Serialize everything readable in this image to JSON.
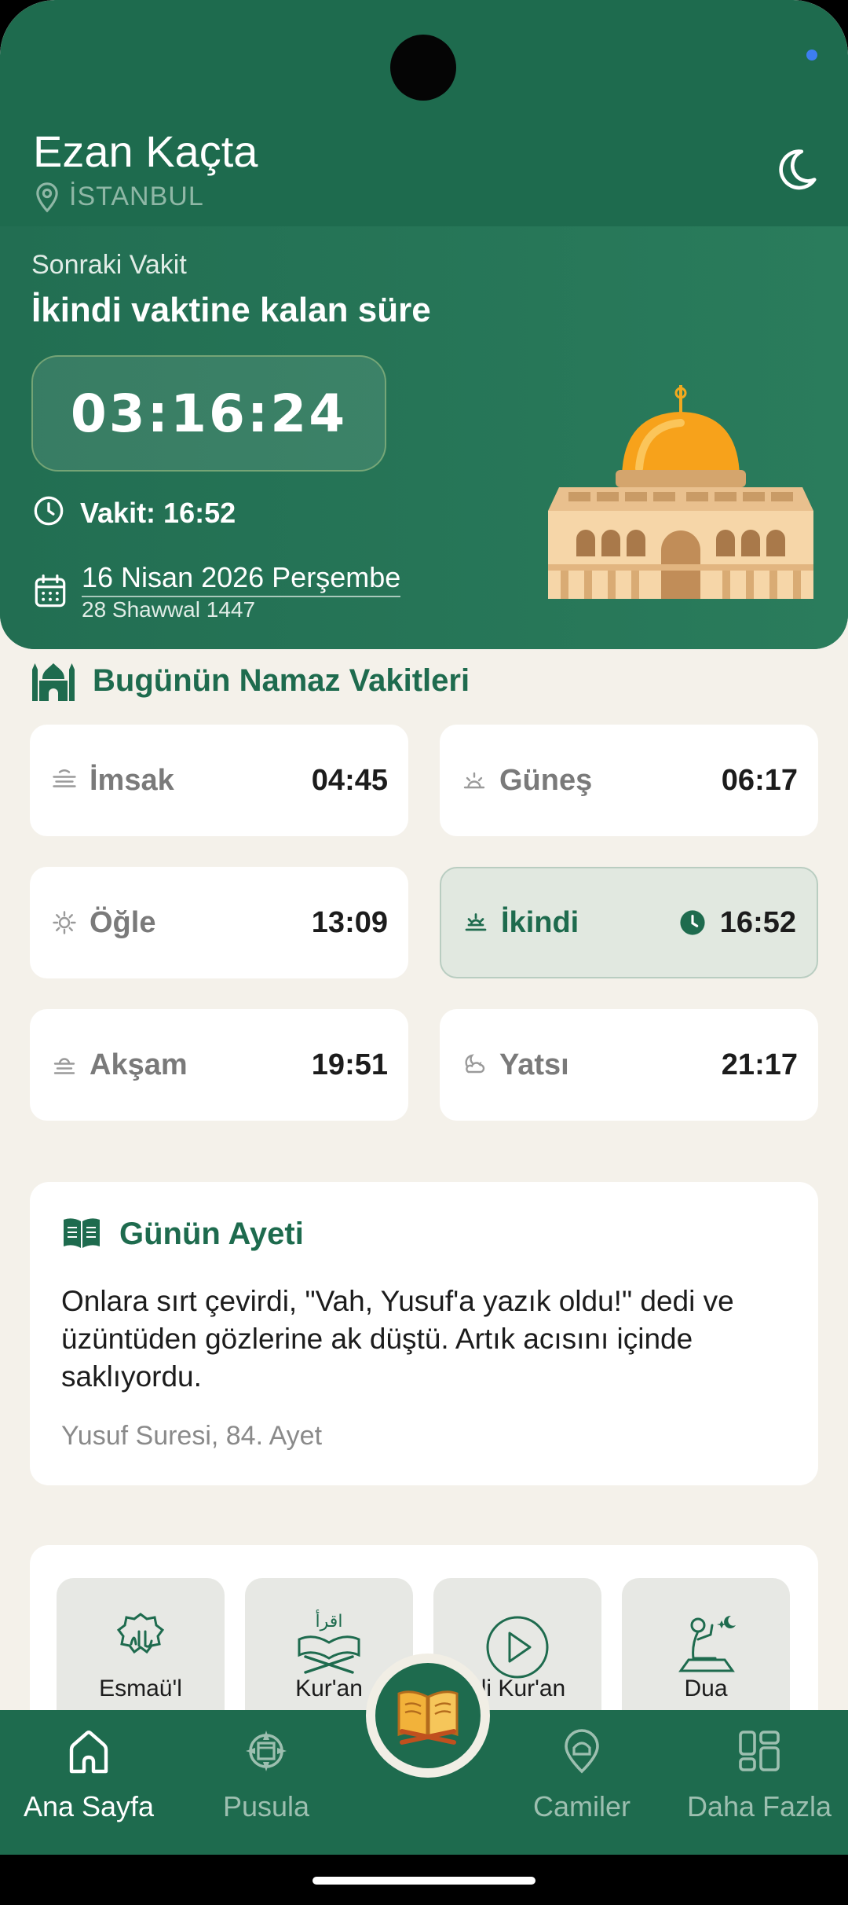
{
  "app": {
    "title": "Ezan Kaçta",
    "location": "İSTANBUL"
  },
  "next": {
    "label": "Sonraki Vakit",
    "title": "İkindi vaktine kalan süre",
    "countdown": "03:16:24",
    "vakit": "Vakit: 16:52",
    "gregorian_date": "16 Nisan 2026 Perşembe",
    "hijri_date": "28 Shawwal 1447"
  },
  "prayers": {
    "section_title": "Bugünün Namaz Vakitleri",
    "items": [
      {
        "name": "İmsak",
        "time": "04:45",
        "icon": "imsak-icon"
      },
      {
        "name": "Güneş",
        "time": "06:17",
        "icon": "sunrise-icon"
      },
      {
        "name": "Öğle",
        "time": "13:09",
        "icon": "sun-icon"
      },
      {
        "name": "İkindi",
        "time": "16:52",
        "icon": "afternoon-icon",
        "active": true
      },
      {
        "name": "Akşam",
        "time": "19:51",
        "icon": "sunset-icon"
      },
      {
        "name": "Yatsı",
        "time": "21:17",
        "icon": "night-icon"
      }
    ]
  },
  "verse": {
    "title": "Günün Ayeti",
    "text": "Onlara sırt çevirdi, \"Vah, Yusuf'a yazık oldu!\" dedi ve üzüntüden gözlerine ak düştü. Artık acısını içinde saklıyordu.",
    "source": "Yusuf Suresi, 84. Ayet"
  },
  "features": [
    {
      "label": "Esmaü'l",
      "icon": "allah-calligraphy-icon"
    },
    {
      "label": "Kur'an",
      "icon": "quran-stand-icon"
    },
    {
      "label": "sli Kur'an",
      "icon": "play-icon"
    },
    {
      "label": "Dua",
      "icon": "praying-person-icon"
    }
  ],
  "nav": [
    {
      "label": "Ana Sayfa",
      "icon": "home-icon",
      "active": true
    },
    {
      "label": "Pusula",
      "icon": "compass-icon"
    },
    {
      "label": "Camiler",
      "icon": "mosque-pin-icon"
    },
    {
      "label": "Daha Fazla",
      "icon": "grid-icon"
    }
  ],
  "colors": {
    "primary": "#1e6b4e",
    "background": "#f4f1ea",
    "accent_dome": "#f7a21b"
  }
}
